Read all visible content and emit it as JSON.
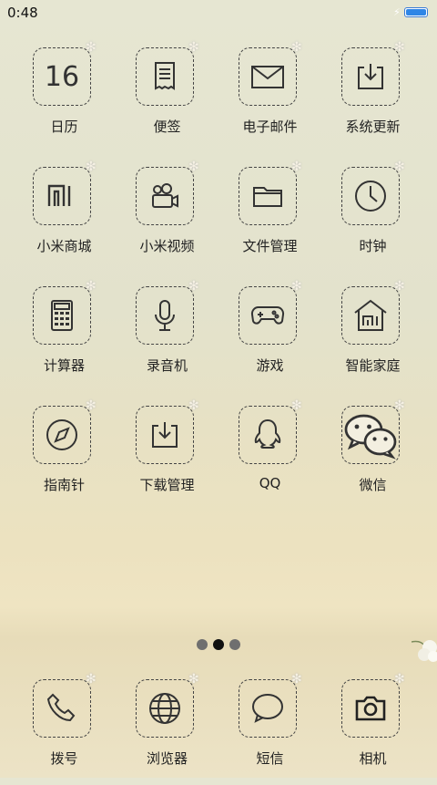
{
  "status_bar": {
    "time": "0:48",
    "battery_percent": 90
  },
  "apps": [
    {
      "label": "日历",
      "icon": "calendar-icon",
      "number": "16"
    },
    {
      "label": "便签",
      "icon": "notes-icon"
    },
    {
      "label": "电子邮件",
      "icon": "mail-icon"
    },
    {
      "label": "系统更新",
      "icon": "system-update-icon"
    },
    {
      "label": "小米商城",
      "icon": "mi-store-icon"
    },
    {
      "label": "小米视频",
      "icon": "video-camera-icon"
    },
    {
      "label": "文件管理",
      "icon": "folder-icon"
    },
    {
      "label": "时钟",
      "icon": "clock-icon"
    },
    {
      "label": "计算器",
      "icon": "calculator-icon"
    },
    {
      "label": "录音机",
      "icon": "microphone-icon"
    },
    {
      "label": "游戏",
      "icon": "gamepad-icon"
    },
    {
      "label": "智能家庭",
      "icon": "smart-home-icon"
    },
    {
      "label": "指南针",
      "icon": "compass-icon"
    },
    {
      "label": "下载管理",
      "icon": "download-icon"
    },
    {
      "label": "QQ",
      "icon": "qq-penguin-icon"
    },
    {
      "label": "微信",
      "icon": "wechat-icon"
    }
  ],
  "dock": [
    {
      "label": "拨号",
      "icon": "phone-icon"
    },
    {
      "label": "浏览器",
      "icon": "globe-icon"
    },
    {
      "label": "短信",
      "icon": "message-icon"
    },
    {
      "label": "相机",
      "icon": "camera-icon"
    }
  ],
  "page_indicator": {
    "pages": 3,
    "current": 2
  }
}
